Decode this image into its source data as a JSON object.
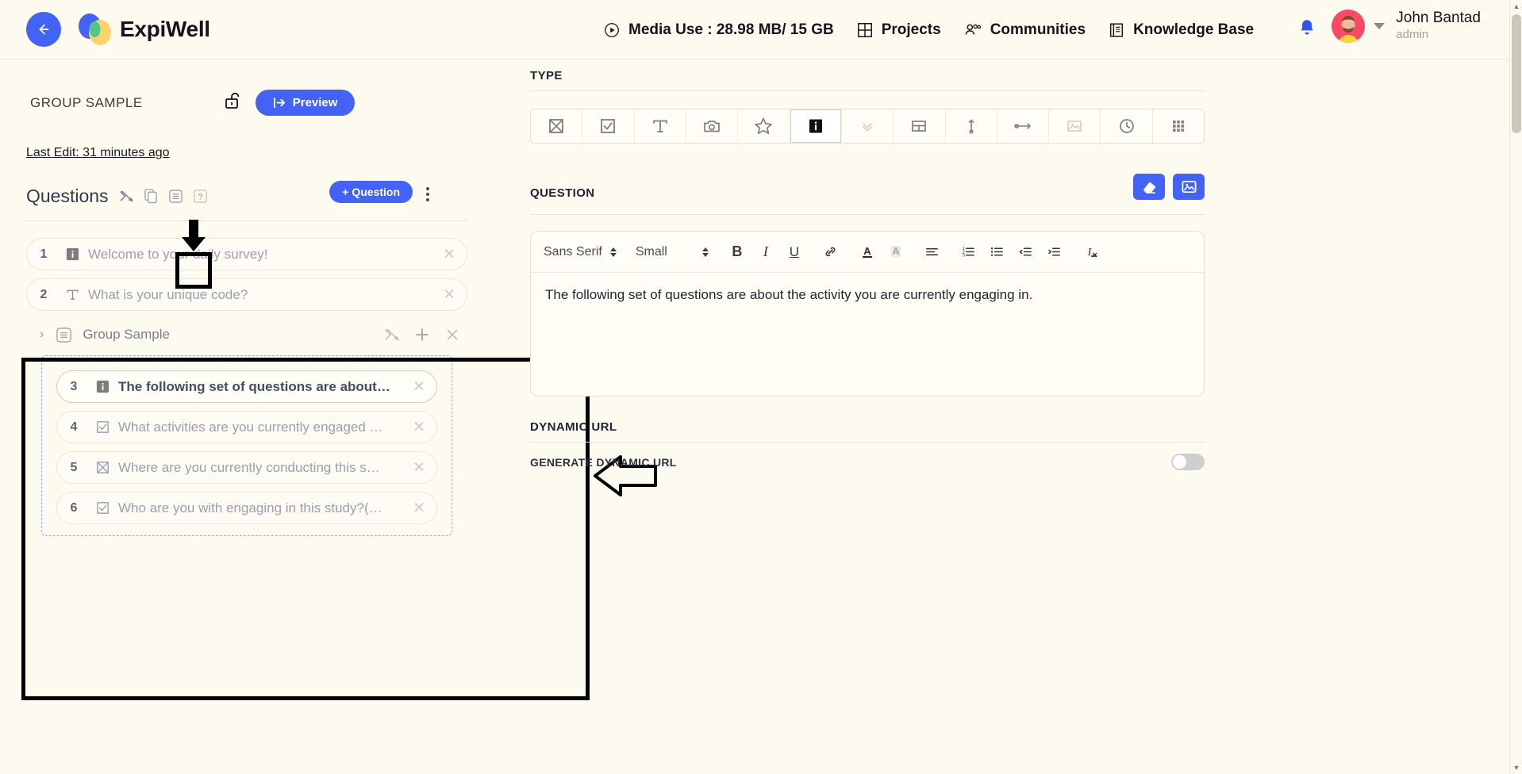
{
  "header": {
    "back_icon": "back-arrow-icon",
    "brand": "ExpiWell",
    "media_use": "Media Use : 28.98 MB/ 15 GB",
    "nav": [
      {
        "label": "Projects",
        "icon": "grid-icon"
      },
      {
        "label": "Communities",
        "icon": "people-icon"
      },
      {
        "label": "Knowledge Base",
        "icon": "book-icon"
      }
    ],
    "notification_icon": "bell-icon",
    "user": {
      "name": "John Bantad",
      "role": "admin"
    }
  },
  "left": {
    "survey_title": "GROUP SAMPLE",
    "lock_icon": "unlocked-padlock-icon",
    "preview_label": "Preview",
    "last_edit": "Last Edit: 31 minutes ago",
    "questions_label": "Questions",
    "tools": [
      {
        "name": "shuffle-icon"
      },
      {
        "name": "duplicate-icon"
      },
      {
        "name": "group-list-icon"
      },
      {
        "name": "help-icon"
      }
    ],
    "add_question_label": "+  Question",
    "questions": [
      {
        "number": "1",
        "icon": "info-icon",
        "text": "Welcome to your daily survey!",
        "active": false
      },
      {
        "number": "2",
        "icon": "text-icon",
        "text": "What is your unique code?",
        "active": false
      }
    ],
    "group": {
      "name": "Group Sample",
      "icon": "group-list-icon",
      "actions": [
        "shuffle-icon",
        "plus-icon",
        "close-icon"
      ],
      "questions": [
        {
          "number": "3",
          "icon": "info-icon",
          "text": "The following set of questions are about…",
          "active": true
        },
        {
          "number": "4",
          "icon": "checkbox-icon",
          "text": "What activities are you currently engaged …",
          "active": false
        },
        {
          "number": "5",
          "icon": "multiple-choice-icon",
          "text": "Where are you currently conducting this s…",
          "active": false
        },
        {
          "number": "6",
          "icon": "checkbox-icon",
          "text": "Who are you with engaging in this study?(…",
          "active": false
        }
      ]
    }
  },
  "right": {
    "type_label": "TYPE",
    "types": [
      {
        "name": "multiple-choice-icon",
        "selected": false
      },
      {
        "name": "checkbox-icon",
        "selected": false
      },
      {
        "name": "text-icon",
        "selected": false
      },
      {
        "name": "camera-icon",
        "selected": false
      },
      {
        "name": "star-rating-icon",
        "selected": false
      },
      {
        "name": "info-icon",
        "selected": true
      },
      {
        "name": "dropdown-icon",
        "selected": false
      },
      {
        "name": "matrix-icon",
        "selected": false
      },
      {
        "name": "slider-icon",
        "selected": false
      },
      {
        "name": "range-icon",
        "selected": false
      },
      {
        "name": "image-choice-icon",
        "selected": false
      },
      {
        "name": "clock-icon",
        "selected": false
      },
      {
        "name": "grid-icon",
        "selected": false
      }
    ],
    "question_label": "QUESTION",
    "question_buttons": [
      "eraser-icon",
      "image-icon"
    ],
    "editor": {
      "font_family": "Sans Serif",
      "font_size": "Small",
      "tools": [
        "bold-icon",
        "italic-icon",
        "underline-icon",
        "link-icon",
        "font-color-icon",
        "highlight-color-icon",
        "align-icon",
        "ordered-list-icon",
        "bullet-list-icon",
        "outdent-icon",
        "indent-icon",
        "clear-format-icon"
      ],
      "content": "The following set of questions are about the activity you are currently engaging in."
    },
    "dynamic_url_label": "DYNAMIC URL",
    "generate_dynamic_url_label": "GENERATE DYNAMIC URL",
    "toggle_on": false
  },
  "colors": {
    "accent": "#4263f5",
    "page_bg": "#fdfaf0",
    "muted_text": "#9aa1ab"
  }
}
